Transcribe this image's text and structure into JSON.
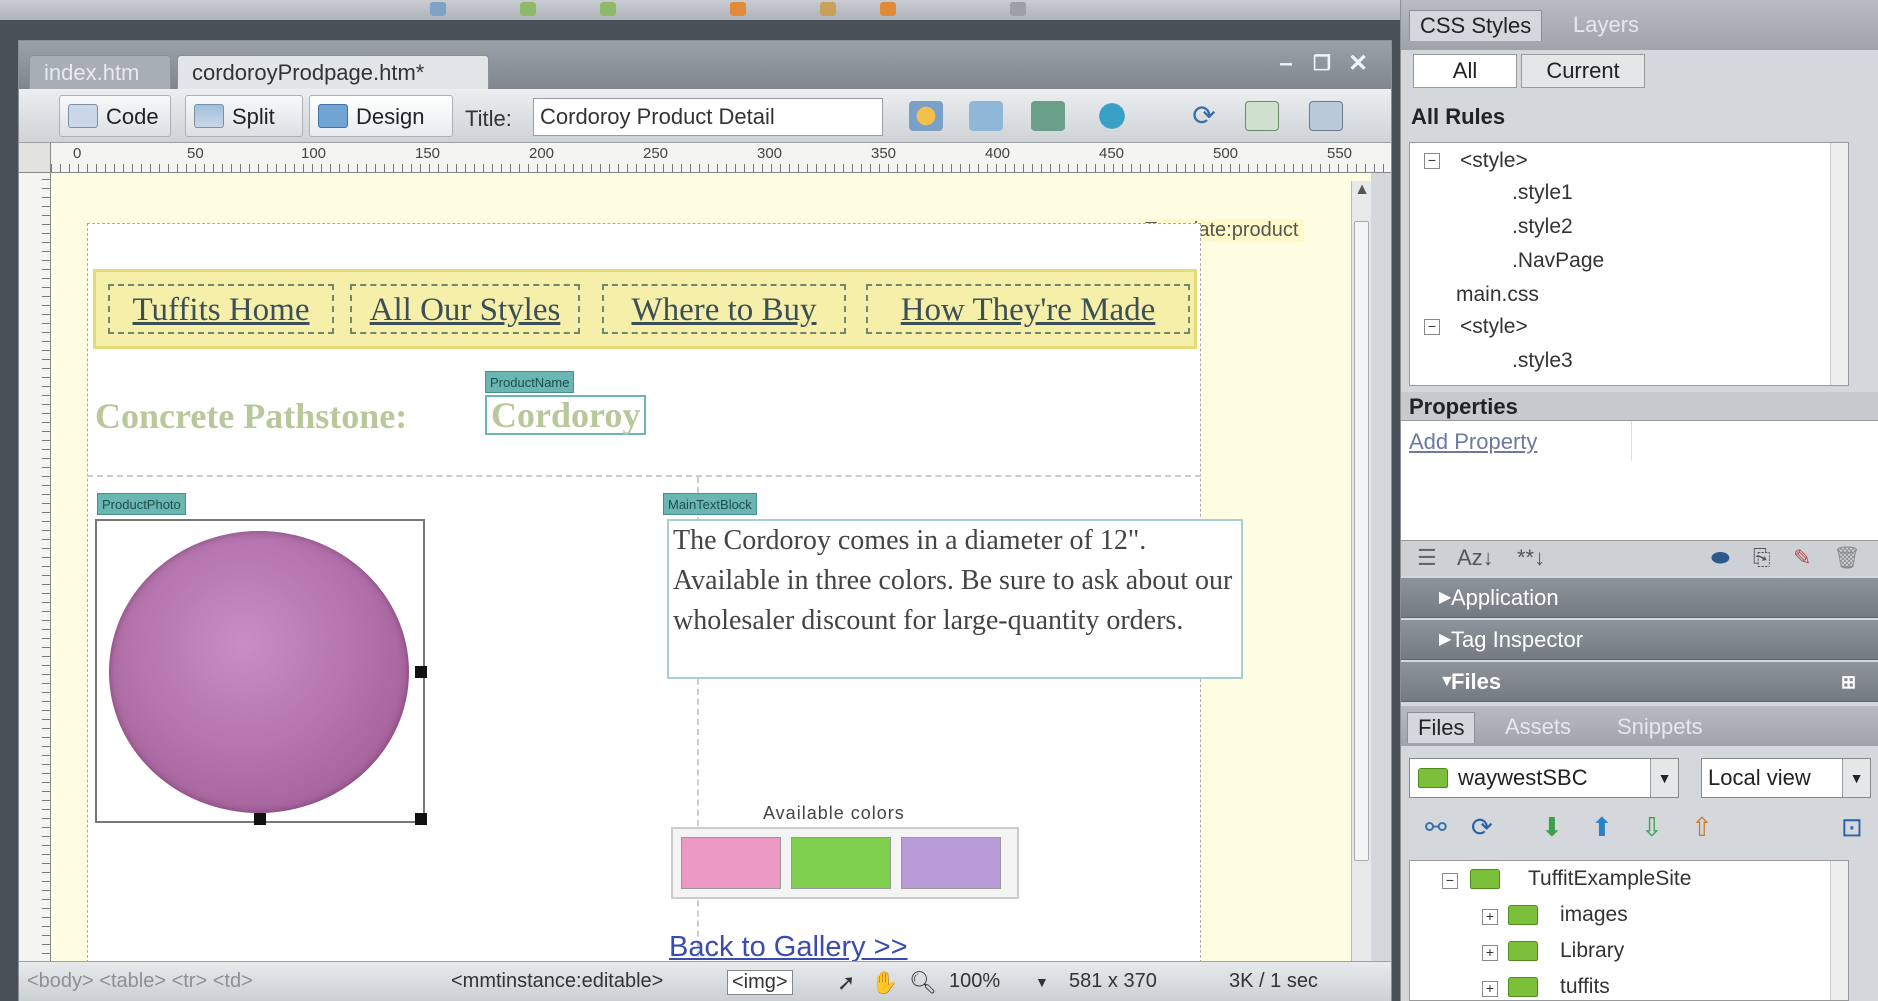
{
  "document": {
    "tabs": [
      {
        "label": "index.htm"
      },
      {
        "label": "cordoroyProdpage.htm*"
      }
    ],
    "view_buttons": {
      "code": "Code",
      "split": "Split",
      "design": "Design"
    },
    "title_label": "Title:",
    "title_value": "Cordoroy Product Detail",
    "ruler_marks": [
      "0",
      "50",
      "100",
      "150",
      "200",
      "250",
      "300",
      "350",
      "400",
      "450",
      "500",
      "550"
    ],
    "template_label": "Template:product",
    "nav_links": [
      "Tuffits Home",
      "All Our Styles",
      "Where to Buy",
      "How They're Made"
    ],
    "product_name_tag": "ProductName",
    "heading_static": "Concrete Pathstone:",
    "heading_editable": "Cordoroy",
    "photo_tag": "ProductPhoto",
    "text_tag": "MainTextBlock",
    "main_text": "The Cordoroy comes in a diameter of 12\". Available in three colors. Be sure to ask about our wholesaler discount for large-quantity orders.",
    "colors_label": "Available colors",
    "swatches": [
      "#ec9ac3",
      "#7fcf4e",
      "#b79ad6"
    ],
    "product_color": "#b476ad",
    "back_link": "Back to Gallery >>"
  },
  "status": {
    "tag_path": "<body> <table> <tr> <td>",
    "editable_tag": "<mmtinstance:editable>",
    "img_tag": "<img>",
    "zoom": "100%",
    "dimensions": "581 x 370",
    "size_time": "3K / 1 sec"
  },
  "panel": {
    "css_tabs": [
      "CSS Styles",
      "Layers"
    ],
    "mode_buttons": [
      "All",
      "Current"
    ],
    "rules_header": "All Rules",
    "rules": [
      {
        "label": "<style>",
        "expander": "−"
      },
      {
        "label": ".style1"
      },
      {
        "label": ".style2"
      },
      {
        "label": ".NavPage"
      },
      {
        "label": "main.css"
      },
      {
        "label": "<style>",
        "expander": "−"
      },
      {
        "label": ".style3"
      }
    ],
    "properties_header": "Properties",
    "add_property": "Add Property",
    "groups": [
      {
        "label": "Application",
        "state": "collapsed"
      },
      {
        "label": "Tag Inspector",
        "state": "collapsed"
      },
      {
        "label": "Files",
        "state": "expanded"
      }
    ],
    "files_tabs": [
      "Files",
      "Assets",
      "Snippets"
    ],
    "site_select": "waywestSBC",
    "view_select": "Local view",
    "file_tree": [
      {
        "label": "TuffitExampleSite",
        "expander": "−"
      },
      {
        "label": "images",
        "expander": "+"
      },
      {
        "label": "Library",
        "expander": "+"
      },
      {
        "label": "tuffits",
        "expander": "+"
      }
    ]
  }
}
